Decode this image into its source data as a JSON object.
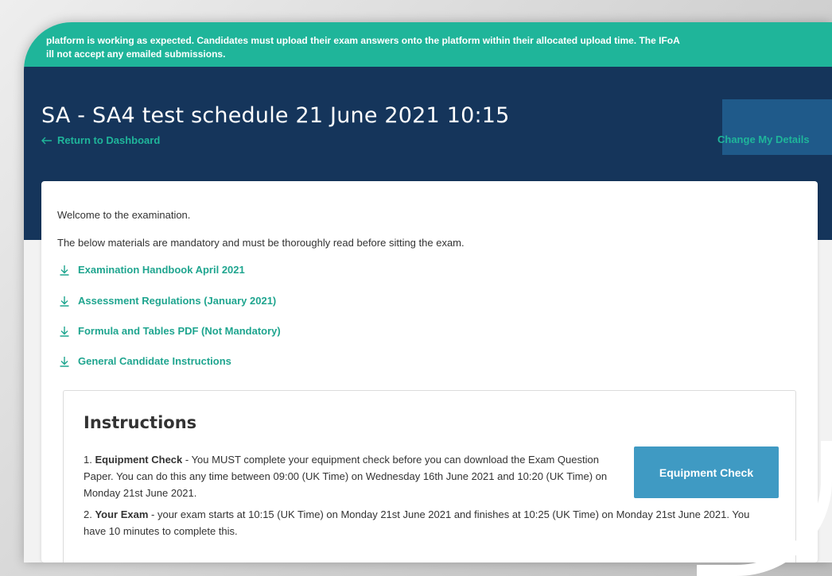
{
  "banner": {
    "line1": "platform is working as expected. Candidates must upload their exam answers onto the platform within their allocated upload time. The IFoA",
    "line2": "ill not accept any emailed submissions."
  },
  "header": {
    "title": "SA - SA4 test schedule 21 June 2021 10:15",
    "return_link": "Return to Dashboard",
    "change_details": "Change My Details"
  },
  "content": {
    "welcome": "Welcome to the examination.",
    "mandatory": "The below materials are mandatory and must be thoroughly read before sitting the exam.",
    "documents": [
      "Examination Handbook April 2021",
      "Assessment Regulations (January 2021)",
      "Formula and Tables PDF (Not Mandatory)",
      "General Candidate Instructions"
    ]
  },
  "instructions": {
    "heading": "Instructions",
    "step1_num": "1.",
    "step1_title": "Equipment Check",
    "step1_text": " - You MUST complete your equipment check before you can download the Exam Question Paper. You can do this any time between 09:00 (UK Time) on Wednesday 16th June 2021 and 10:20 (UK Time) on Monday 21st June 2021.",
    "step2_num": "2.",
    "step2_title": "Your Exam",
    "step2_text": " - your exam starts at 10:15 (UK Time) on Monday 21st June 2021 and finishes at 10:25 (UK Time) on Monday 21st June 2021. You have 10 minutes to complete this.",
    "button_label": "Equipment Check"
  },
  "icons": {
    "download": "download-icon",
    "return_arrow": "arrow-left-icon"
  },
  "colors": {
    "banner": "#1fb59a",
    "header": "#15355b",
    "link": "#1fa58f",
    "button": "#3f9ac3"
  }
}
